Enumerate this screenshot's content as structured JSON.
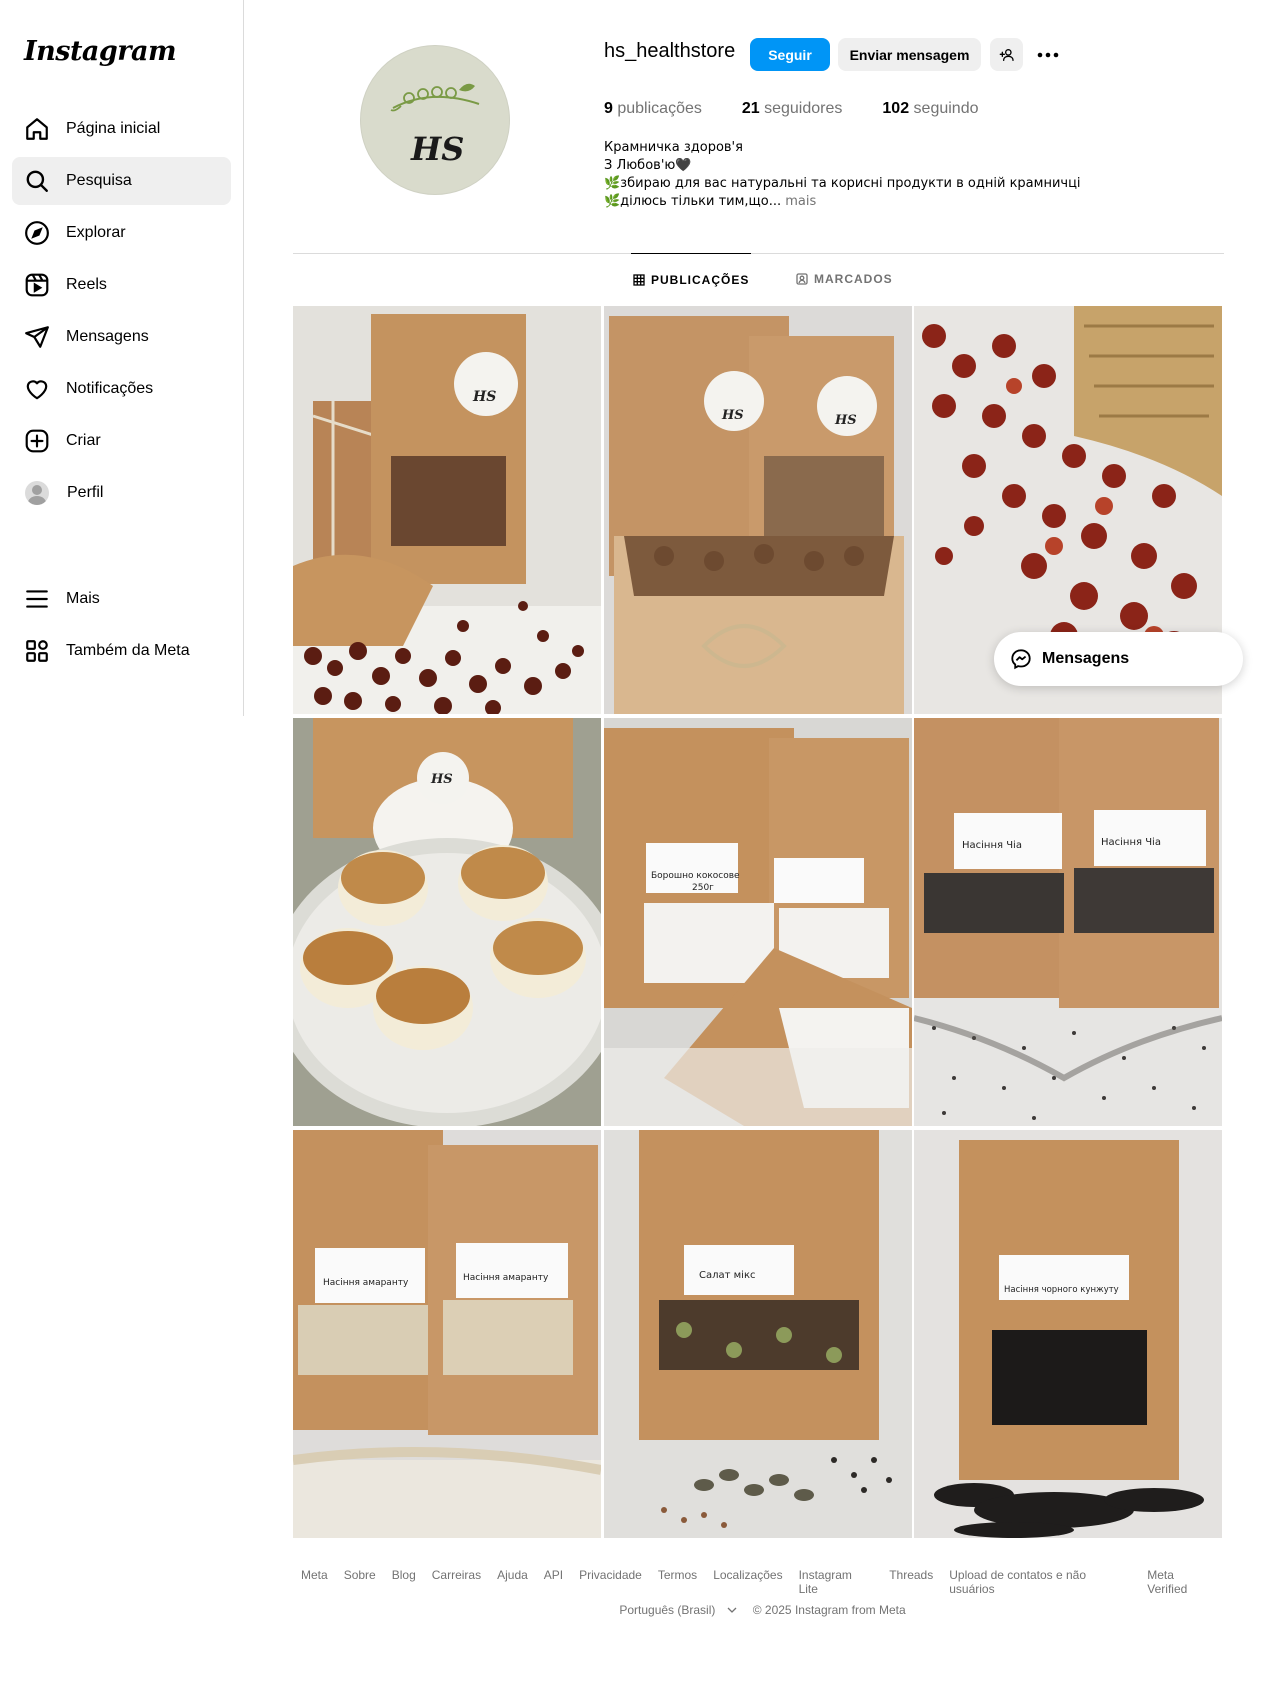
{
  "brand": {
    "logo_text": "Instagram",
    "accent": "#0095f6"
  },
  "sidebar": {
    "items": [
      {
        "label": "Página inicial",
        "icon": "home-icon"
      },
      {
        "label": "Pesquisa",
        "icon": "search-icon",
        "active": true
      },
      {
        "label": "Explorar",
        "icon": "compass-icon"
      },
      {
        "label": "Reels",
        "icon": "reels-icon"
      },
      {
        "label": "Mensagens",
        "icon": "send-icon"
      },
      {
        "label": "Notificações",
        "icon": "heart-icon"
      },
      {
        "label": "Criar",
        "icon": "plus-square-icon"
      },
      {
        "label": "Perfil",
        "icon": "avatar"
      },
      {
        "label": "Mais",
        "icon": "menu-icon"
      },
      {
        "label": "Também da Meta",
        "icon": "grid-apps-icon"
      }
    ]
  },
  "profile": {
    "avatar_text": "HS",
    "username": "hs_healthstore",
    "follow_label": "Seguir",
    "message_label": "Enviar mensagem",
    "stats": {
      "posts_count": "9",
      "posts_label": "publicações",
      "followers_count": "21",
      "followers_label": "seguidores",
      "following_count": "102",
      "following_label": "seguindo"
    },
    "bio": {
      "line1": "Крамничка здоров'я",
      "line2": "З Любов'ю🖤",
      "line3": "🌿збираю для вас натуральні та корисні продукти в одній крамничці",
      "line4": "🌿ділюсь тільки тим,що...",
      "more": " mais"
    }
  },
  "tabs": {
    "posts": "PUBLICAÇÕES",
    "tagged": "MARCADOS"
  },
  "posts": [
    {
      "label": "HS"
    },
    {
      "label": "HS"
    },
    {
      "label": ""
    },
    {
      "label": "HS"
    },
    {
      "label": "Борошно кокосове 250г"
    },
    {
      "label": "Насіння Чіа"
    },
    {
      "label": "Насіння амаранту"
    },
    {
      "label": "Салат мікс"
    },
    {
      "label": "Насіння чорного кунжуту"
    }
  ],
  "floating": {
    "messages_label": "Mensagens"
  },
  "footer": {
    "links": [
      "Meta",
      "Sobre",
      "Blog",
      "Carreiras",
      "Ajuda",
      "API",
      "Privacidade",
      "Termos",
      "Localizações",
      "Instagram Lite",
      "Threads",
      "Upload de contatos e não usuários",
      "Meta Verified"
    ],
    "language": "Português (Brasil)",
    "copyright": "© 2025 Instagram from Meta"
  }
}
